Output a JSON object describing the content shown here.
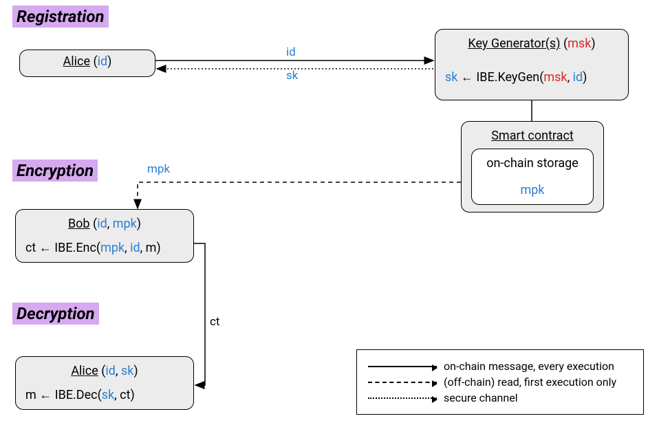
{
  "sections": {
    "registration": "Registration",
    "encryption": "Encryption",
    "decryption": "Decryption"
  },
  "alice_reg": {
    "name": "Alice",
    "param_open": " (",
    "id": "id",
    "param_close": ")"
  },
  "keygen": {
    "name": "Key Generator(s)",
    "param_open": " (",
    "msk": "msk",
    "param_close": ")",
    "sk": "sk",
    "arrow": " ← IBE.KeyGen(",
    "msk2": "msk",
    "sep": ", ",
    "id": "id",
    "end": ")"
  },
  "smart_contract": {
    "title": "Smart contract",
    "storage": "on-chain storage",
    "mpk": "mpk"
  },
  "bob": {
    "name": "Bob",
    "param_open": " (",
    "id": "id",
    "sep": ", ",
    "mpk": "mpk",
    "param_close": ")",
    "ct_line_a": "ct ← IBE.Enc(",
    "mpk2": "mpk",
    "sep2": ", ",
    "id2": "id",
    "sep3": ", m)"
  },
  "alice_dec": {
    "name": "Alice",
    "param_open": " (",
    "id": "id",
    "sep": ", ",
    "sk": "sk",
    "param_close": ")",
    "line_a": "m ← IBE.Dec(",
    "sk2": "sk",
    "line_b": ", ct)"
  },
  "arrows": {
    "id": "id",
    "sk": "sk",
    "mpk": "mpk",
    "ct": "ct"
  },
  "legend": {
    "solid": "on-chain message, every execution",
    "dashed": "(off-chain) read, first execution only",
    "dotted": "secure channel"
  }
}
